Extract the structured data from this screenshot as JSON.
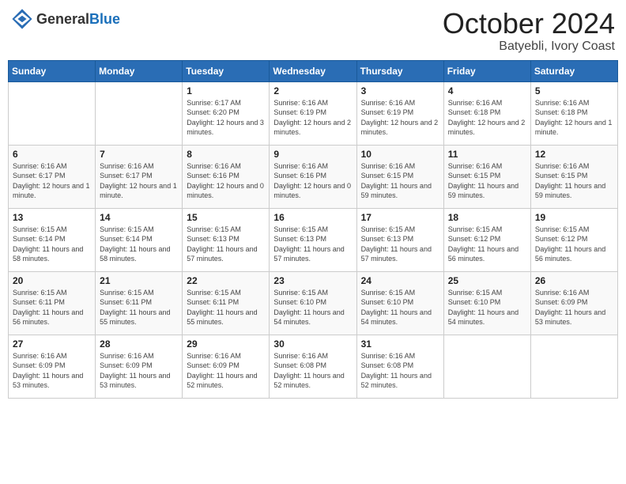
{
  "header": {
    "logo_general": "General",
    "logo_blue": "Blue",
    "month": "October 2024",
    "location": "Batyebli, Ivory Coast"
  },
  "days_of_week": [
    "Sunday",
    "Monday",
    "Tuesday",
    "Wednesday",
    "Thursday",
    "Friday",
    "Saturday"
  ],
  "weeks": [
    [
      {
        "day": "",
        "info": ""
      },
      {
        "day": "",
        "info": ""
      },
      {
        "day": "1",
        "info": "Sunrise: 6:17 AM\nSunset: 6:20 PM\nDaylight: 12 hours and 3 minutes."
      },
      {
        "day": "2",
        "info": "Sunrise: 6:16 AM\nSunset: 6:19 PM\nDaylight: 12 hours and 2 minutes."
      },
      {
        "day": "3",
        "info": "Sunrise: 6:16 AM\nSunset: 6:19 PM\nDaylight: 12 hours and 2 minutes."
      },
      {
        "day": "4",
        "info": "Sunrise: 6:16 AM\nSunset: 6:18 PM\nDaylight: 12 hours and 2 minutes."
      },
      {
        "day": "5",
        "info": "Sunrise: 6:16 AM\nSunset: 6:18 PM\nDaylight: 12 hours and 1 minute."
      }
    ],
    [
      {
        "day": "6",
        "info": "Sunrise: 6:16 AM\nSunset: 6:17 PM\nDaylight: 12 hours and 1 minute."
      },
      {
        "day": "7",
        "info": "Sunrise: 6:16 AM\nSunset: 6:17 PM\nDaylight: 12 hours and 1 minute."
      },
      {
        "day": "8",
        "info": "Sunrise: 6:16 AM\nSunset: 6:16 PM\nDaylight: 12 hours and 0 minutes."
      },
      {
        "day": "9",
        "info": "Sunrise: 6:16 AM\nSunset: 6:16 PM\nDaylight: 12 hours and 0 minutes."
      },
      {
        "day": "10",
        "info": "Sunrise: 6:16 AM\nSunset: 6:15 PM\nDaylight: 11 hours and 59 minutes."
      },
      {
        "day": "11",
        "info": "Sunrise: 6:16 AM\nSunset: 6:15 PM\nDaylight: 11 hours and 59 minutes."
      },
      {
        "day": "12",
        "info": "Sunrise: 6:16 AM\nSunset: 6:15 PM\nDaylight: 11 hours and 59 minutes."
      }
    ],
    [
      {
        "day": "13",
        "info": "Sunrise: 6:15 AM\nSunset: 6:14 PM\nDaylight: 11 hours and 58 minutes."
      },
      {
        "day": "14",
        "info": "Sunrise: 6:15 AM\nSunset: 6:14 PM\nDaylight: 11 hours and 58 minutes."
      },
      {
        "day": "15",
        "info": "Sunrise: 6:15 AM\nSunset: 6:13 PM\nDaylight: 11 hours and 57 minutes."
      },
      {
        "day": "16",
        "info": "Sunrise: 6:15 AM\nSunset: 6:13 PM\nDaylight: 11 hours and 57 minutes."
      },
      {
        "day": "17",
        "info": "Sunrise: 6:15 AM\nSunset: 6:13 PM\nDaylight: 11 hours and 57 minutes."
      },
      {
        "day": "18",
        "info": "Sunrise: 6:15 AM\nSunset: 6:12 PM\nDaylight: 11 hours and 56 minutes."
      },
      {
        "day": "19",
        "info": "Sunrise: 6:15 AM\nSunset: 6:12 PM\nDaylight: 11 hours and 56 minutes."
      }
    ],
    [
      {
        "day": "20",
        "info": "Sunrise: 6:15 AM\nSunset: 6:11 PM\nDaylight: 11 hours and 56 minutes."
      },
      {
        "day": "21",
        "info": "Sunrise: 6:15 AM\nSunset: 6:11 PM\nDaylight: 11 hours and 55 minutes."
      },
      {
        "day": "22",
        "info": "Sunrise: 6:15 AM\nSunset: 6:11 PM\nDaylight: 11 hours and 55 minutes."
      },
      {
        "day": "23",
        "info": "Sunrise: 6:15 AM\nSunset: 6:10 PM\nDaylight: 11 hours and 54 minutes."
      },
      {
        "day": "24",
        "info": "Sunrise: 6:15 AM\nSunset: 6:10 PM\nDaylight: 11 hours and 54 minutes."
      },
      {
        "day": "25",
        "info": "Sunrise: 6:15 AM\nSunset: 6:10 PM\nDaylight: 11 hours and 54 minutes."
      },
      {
        "day": "26",
        "info": "Sunrise: 6:16 AM\nSunset: 6:09 PM\nDaylight: 11 hours and 53 minutes."
      }
    ],
    [
      {
        "day": "27",
        "info": "Sunrise: 6:16 AM\nSunset: 6:09 PM\nDaylight: 11 hours and 53 minutes."
      },
      {
        "day": "28",
        "info": "Sunrise: 6:16 AM\nSunset: 6:09 PM\nDaylight: 11 hours and 53 minutes."
      },
      {
        "day": "29",
        "info": "Sunrise: 6:16 AM\nSunset: 6:09 PM\nDaylight: 11 hours and 52 minutes."
      },
      {
        "day": "30",
        "info": "Sunrise: 6:16 AM\nSunset: 6:08 PM\nDaylight: 11 hours and 52 minutes."
      },
      {
        "day": "31",
        "info": "Sunrise: 6:16 AM\nSunset: 6:08 PM\nDaylight: 11 hours and 52 minutes."
      },
      {
        "day": "",
        "info": ""
      },
      {
        "day": "",
        "info": ""
      }
    ]
  ]
}
